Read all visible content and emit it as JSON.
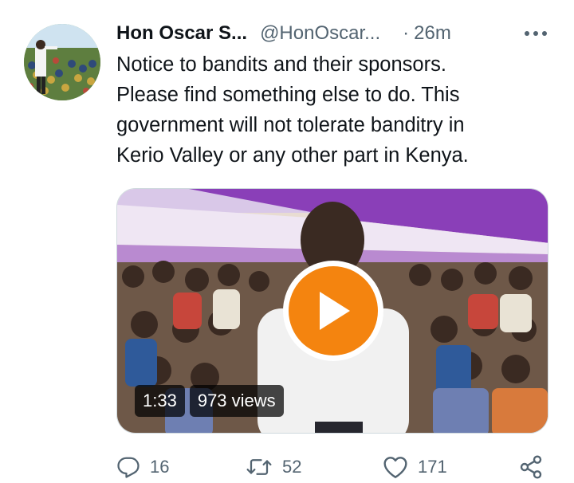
{
  "tweet": {
    "author_name": "Hon Oscar S...",
    "handle": "@HonOscar...",
    "separator": "·",
    "time": "26m",
    "text_lines": [
      "Notice to bandits and their sponsors.",
      "Please find something else to do. This",
      "government will not tolerate banditry in",
      "Kerio Valley or any other part in Kenya."
    ]
  },
  "video": {
    "duration": "1:33",
    "views": "973 views"
  },
  "actions": {
    "reply_count": "16",
    "retweet_count": "52",
    "like_count": "171"
  },
  "icons": {
    "more": "more-dots-icon",
    "reply": "reply-bubble-icon",
    "retweet": "retweet-arrows-icon",
    "like": "heart-icon",
    "share": "share-icon",
    "play": "play-icon"
  },
  "colors": {
    "play_button": "#f4840f",
    "muted_text": "#536471",
    "primary_text": "#0f1419",
    "tent_purple": "#8a3fb8"
  }
}
